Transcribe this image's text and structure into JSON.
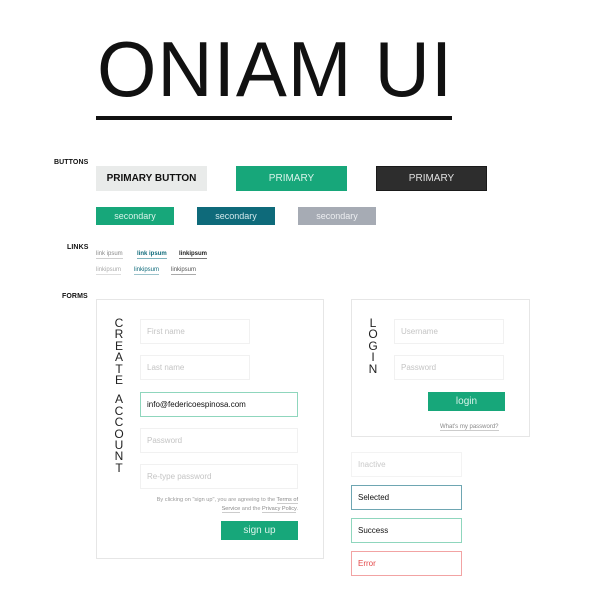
{
  "header": {
    "title": "ONIAM UI"
  },
  "sections": {
    "buttons": "BUTTONS",
    "links": "LINKS",
    "forms": "FORMS"
  },
  "buttons": {
    "primary_light": "PRIMARY BUTTON",
    "primary_green": "PRIMARY",
    "primary_dark": "PRIMARY",
    "secondary_green": "secondary",
    "secondary_teal": "secondary",
    "secondary_grey": "secondary"
  },
  "links": [
    "link ipsum",
    "link ipsum",
    "linkipsum",
    "linkipsum",
    "linkipsum",
    "linkipsum"
  ],
  "create_account": {
    "title_line1": [
      "C",
      "R",
      "E",
      "A",
      "T",
      "E"
    ],
    "title_line2": [
      "A",
      "C",
      "C",
      "O",
      "U",
      "N",
      "T"
    ],
    "first_name_placeholder": "First name",
    "last_name_placeholder": "Last name",
    "email_value": "info@federicoespinosa.com",
    "password_placeholder": "Password",
    "retype_placeholder": "Re-type password",
    "terms_prefix": "By clicking on \"sign up\", you are agreeing to the",
    "terms_link": "Terms of Service",
    "terms_mid": "and the",
    "privacy_link": "Privacy Policy",
    "terms_suffix": ".",
    "signup_label": "sign up"
  },
  "login": {
    "title": [
      "L",
      "O",
      "G",
      "I",
      "N"
    ],
    "username_placeholder": "Username",
    "password_placeholder": "Password",
    "login_label": "login",
    "forgot_label": "What's my password?"
  },
  "input_states": {
    "inactive": "Inactive",
    "selected": "Selected",
    "success": "Success",
    "error": "Error"
  },
  "colors": {
    "primary_green": "#17a77a",
    "teal": "#0e6a7a",
    "dark": "#2d2d2d",
    "grey": "#a6abb4",
    "light": "#e9ebea",
    "success_border": "#8fd6bd",
    "selected_border": "#6ea6b2",
    "error": "#e34848"
  }
}
